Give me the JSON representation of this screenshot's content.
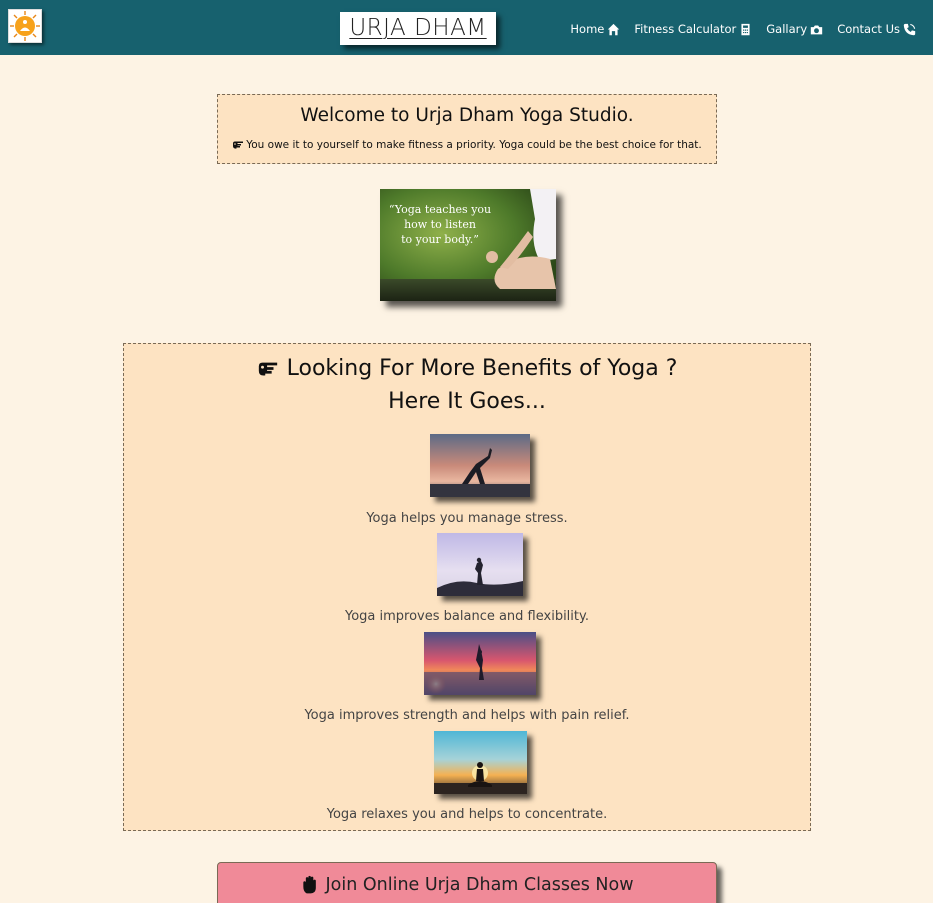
{
  "brand": {
    "name": "URJA DHAM"
  },
  "nav": [
    {
      "label": "Home",
      "icon": "home-icon"
    },
    {
      "label": "Fitness Calculator",
      "icon": "calculator-icon"
    },
    {
      "label": "Gallary",
      "icon": "camera-icon"
    },
    {
      "label": "Contact Us",
      "icon": "phone-icon"
    }
  ],
  "welcome": {
    "title": "Welcome to Urja Dham Yoga Studio.",
    "subtitle": "You owe it to yourself to make fitness a priority. Yoga could be the best choice for that."
  },
  "hero": {
    "quote_line1": "“Yoga teaches you",
    "quote_line2": "how to listen",
    "quote_line3": "to your body.”"
  },
  "benefits": {
    "title": "Looking For More Benefits of Yoga ?",
    "subtitle": "Here It Goes...",
    "items": [
      {
        "caption": "Yoga helps you manage stress."
      },
      {
        "caption": "Yoga improves balance and flexibility."
      },
      {
        "caption": "Yoga improves strength and helps with pain relief."
      },
      {
        "caption": "Yoga relaxes you and helps to concentrate."
      }
    ]
  },
  "join": {
    "label": "Join Online Urja Dham Classes Now"
  },
  "colors": {
    "navbar": "#17616e",
    "page_bg": "#fdf3e4",
    "box_bg": "#fde3c2",
    "join_bg": "#f08a98"
  }
}
